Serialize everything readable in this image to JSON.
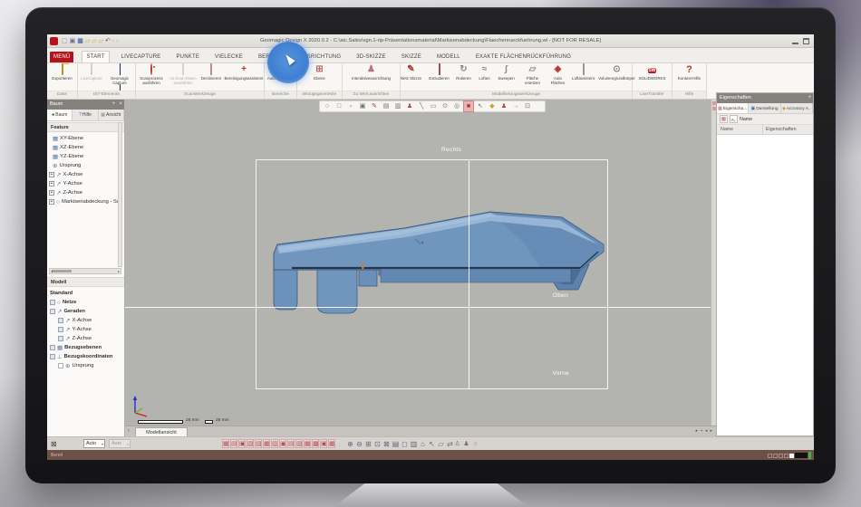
{
  "titlebar": {
    "title": "Geomagic Design X 2020.0.2 - C:\\aic.Sales\\vgn.1-rip-Präsentationsmaterial\\Markisenabdeckung\\Flaechenrueckfuehrung.wl - [NOT FOR RESALE]"
  },
  "qat_icons": [
    "▢",
    "▣",
    "▦",
    "▱",
    "▱",
    "▱",
    "↶",
    "‹",
    "›"
  ],
  "tabs": [
    "MENÜ",
    "START",
    "LIVECAPTURE",
    "PUNKTE",
    "VIELECKE",
    "BEREICH",
    "AUSRICHTUNG",
    "3D-SKIZZE",
    "SKIZZE",
    "MODELL",
    "EXAKTE FLÄCHENRÜCKFÜHRUNG"
  ],
  "ribbon": {
    "groups": [
      {
        "label": "Datei",
        "buttons": [
          {
            "label": "Exportieren"
          }
        ]
      },
      {
        "label": "IST-Elemente",
        "buttons": [
          {
            "label": "LiveCapture"
          },
          {
            "label": "Geomagic Capture"
          }
        ]
      },
      {
        "label": "ScanWerkzeuge",
        "buttons": [
          {
            "label": "Scanprozess ausführen"
          },
          {
            "label": "Ist-Scan-Daten auswählen"
          },
          {
            "label": "Dezimieren"
          },
          {
            "label": "Bereinigungsassistent"
          }
        ]
      },
      {
        "label": "Bereiche",
        "buttons": [
          {
            "label": "Auto Aufteilung"
          }
        ]
      },
      {
        "label": "Bezugsgeometrie",
        "buttons": [
          {
            "label": "Ebene"
          }
        ]
      },
      {
        "label": "Zu Welt ausrichten",
        "buttons": [
          {
            "label": "Interaktiveausrichtung"
          }
        ]
      },
      {
        "label": "Modellierungswerkzeuge",
        "buttons": [
          {
            "label": "Netz Skizze"
          },
          {
            "label": "Extrudieren"
          },
          {
            "label": "Rotieren"
          },
          {
            "label": "Loften"
          },
          {
            "label": "Sweepen"
          },
          {
            "label": "Fläche ersetzen"
          },
          {
            "label": "Auto Flächen"
          },
          {
            "label": "Loftassistent"
          },
          {
            "label": "Volumengrundkörper"
          }
        ]
      },
      {
        "label": "LiveTransfer",
        "buttons": [
          {
            "label": "SOLIDWORKS"
          }
        ]
      },
      {
        "label": "Hilfe",
        "buttons": [
          {
            "label": "Kontext-Hilfe"
          }
        ]
      }
    ]
  },
  "left_panel": {
    "title": "Baum",
    "tabs": [
      "Baum",
      "Hilfe",
      "Ansicht"
    ],
    "feature_header": "Feature",
    "feature_tree": [
      {
        "label": "XY-Ebene"
      },
      {
        "label": "XZ-Ebene"
      },
      {
        "label": "YZ-Ebene"
      },
      {
        "label": "Ursprung"
      },
      {
        "label": "X-Achse"
      },
      {
        "label": "Y-Achse"
      },
      {
        "label": "Z-Achse"
      },
      {
        "label": "Markisenabdeckung - Sc"
      }
    ],
    "model_header": "Modell",
    "model_tree": [
      {
        "label": "Standard"
      },
      {
        "label": "Netze"
      },
      {
        "label": "Geraden"
      },
      {
        "label": "X-Achse"
      },
      {
        "label": "Y-Achse"
      },
      {
        "label": "Z-Achse"
      },
      {
        "label": "Bezugsebenen"
      },
      {
        "label": "Bezugskoordinaten"
      },
      {
        "label": "Ursprung"
      }
    ]
  },
  "viewport": {
    "view_labels": {
      "right": "Rechts",
      "top": "Oben",
      "front": "Vorne"
    },
    "scale_long": "25 mm",
    "scale_short": "25 mm",
    "view_tab": "Modellansicht",
    "float_icons": [
      "○",
      "□",
      "▫",
      "▣",
      "✎",
      "▤",
      "▥",
      "♟",
      "╲",
      "▭",
      "⊙",
      "◎",
      "■",
      "↖",
      "◆",
      "♟",
      "→",
      "⊡"
    ]
  },
  "right_panel": {
    "title": "Eigenschaften",
    "tabs": [
      "Eigenscha...",
      "Darstellung",
      "Accuracy A.."
    ],
    "sort_icon": "A↓",
    "sort_label": "Name",
    "columns": [
      "Name",
      "Eigenschaften"
    ]
  },
  "bottom": {
    "auto1": "Auto",
    "auto2": "Auto",
    "view_icons": [
      "▦",
      "▤",
      "▣",
      "▧",
      "▨",
      "▦",
      "▥",
      "▣",
      "▤",
      "▧",
      "▦",
      "▩",
      "▣",
      "▦"
    ],
    "zoom_icons": [
      "⊕",
      "⊖",
      "⊞",
      "⊡",
      "⊠",
      "▤",
      "◻",
      "▥",
      "⌂",
      "↖",
      "▱",
      "⇄"
    ],
    "misc_icons": [
      "♙",
      "♟",
      "○"
    ],
    "tab_arrows": [
      "▸",
      "▪",
      "◂",
      "▸"
    ],
    "status": "Bereit"
  },
  "icons": {
    "expander": "+",
    "plane": "▦",
    "origin": "⊕",
    "axis": "↗",
    "mesh": "○",
    "coord": "⊥",
    "ebene": "⊞",
    "interaktiv": "♟",
    "netz_skizze": "✎",
    "rotieren": "↻",
    "loften": "≈",
    "sweepen": "∫",
    "flaeche": "▱",
    "auto_flaechen": "◈",
    "volumen": "⊙",
    "auto_aufteilung": "▩",
    "sw_badge": "SW",
    "help_q": "?",
    "cross": "+",
    "pin": "+",
    "close": "×",
    "dropdown": "▾",
    "back": "‹",
    "dot": ".",
    "baum_tab": "♣",
    "hilfe_tab": "?",
    "ansicht_tab": "▦",
    "prop_tab": "▦",
    "display_tab": "▣",
    "accuracy_tab": "◆",
    "fit": "⊠",
    "grid": "▦"
  },
  "colors": {
    "menu_red": "#b5121b",
    "model_blue": "#7096be",
    "click_highlight": "#3f7fd2",
    "status_bar": "#6d5147",
    "viewport_bg": "#b3b3b0"
  }
}
